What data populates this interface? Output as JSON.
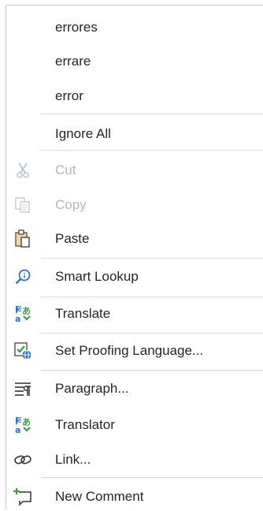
{
  "menu": {
    "suggestions": [
      "errores",
      "errare",
      "error"
    ],
    "ignore_all": "Ignore All",
    "cut": "Cut",
    "copy": "Copy",
    "paste": "Paste",
    "smart_lookup": "Smart Lookup",
    "translate": "Translate",
    "set_proofing_language": "Set Proofing Language...",
    "paragraph": "Paragraph...",
    "translator": "Translator",
    "link": "Link...",
    "new_comment": "New Comment"
  },
  "icons": {
    "cut": "scissors-icon",
    "copy": "copy-icon",
    "paste": "clipboard-icon",
    "smart_lookup": "search-icon",
    "translate": "translate-icon",
    "set_proofing_language": "proofing-language-icon",
    "paragraph": "paragraph-icon",
    "translator": "translator-icon",
    "link": "link-icon",
    "new_comment": "new-comment-icon"
  },
  "colors": {
    "accent_blue": "#2f72c4",
    "accent_green": "#3f9b3f",
    "disabled_text": "#b7b7b7",
    "text": "#262626"
  }
}
